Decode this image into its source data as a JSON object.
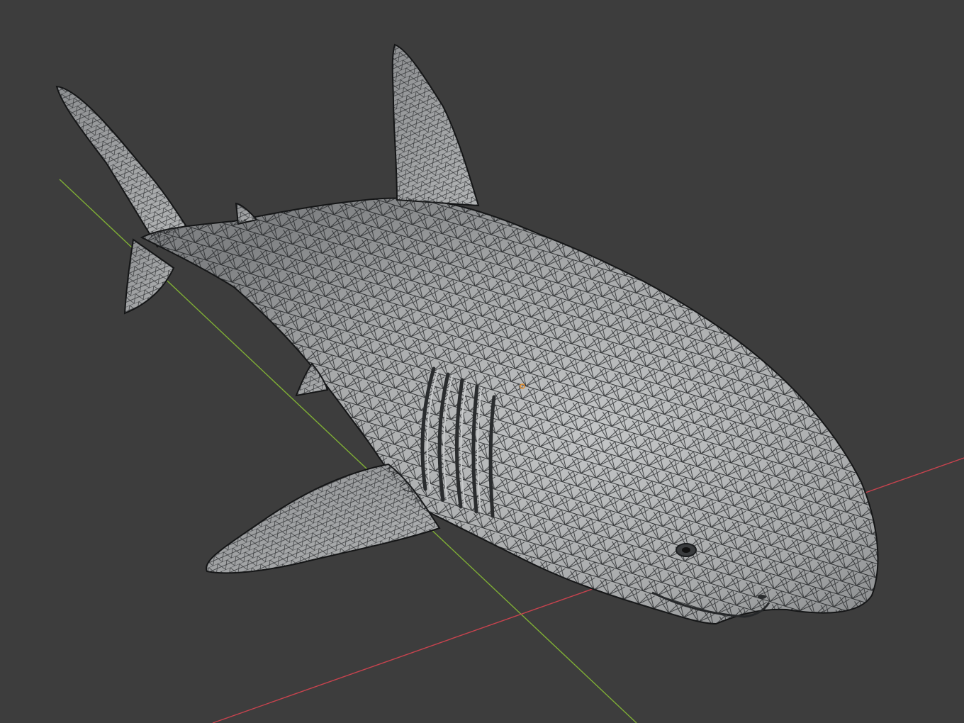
{
  "viewport": {
    "background_color": "#3d3d3d",
    "view_mode": "solid-wireframe-overlay"
  },
  "axes": {
    "x_axis_color": "#c8434e",
    "y_axis_color": "#7fae35"
  },
  "object": {
    "mesh_fill_color": "#a3a5a6",
    "wire_color": "#1e2022",
    "origin_marker_color": "#e8902c"
  }
}
